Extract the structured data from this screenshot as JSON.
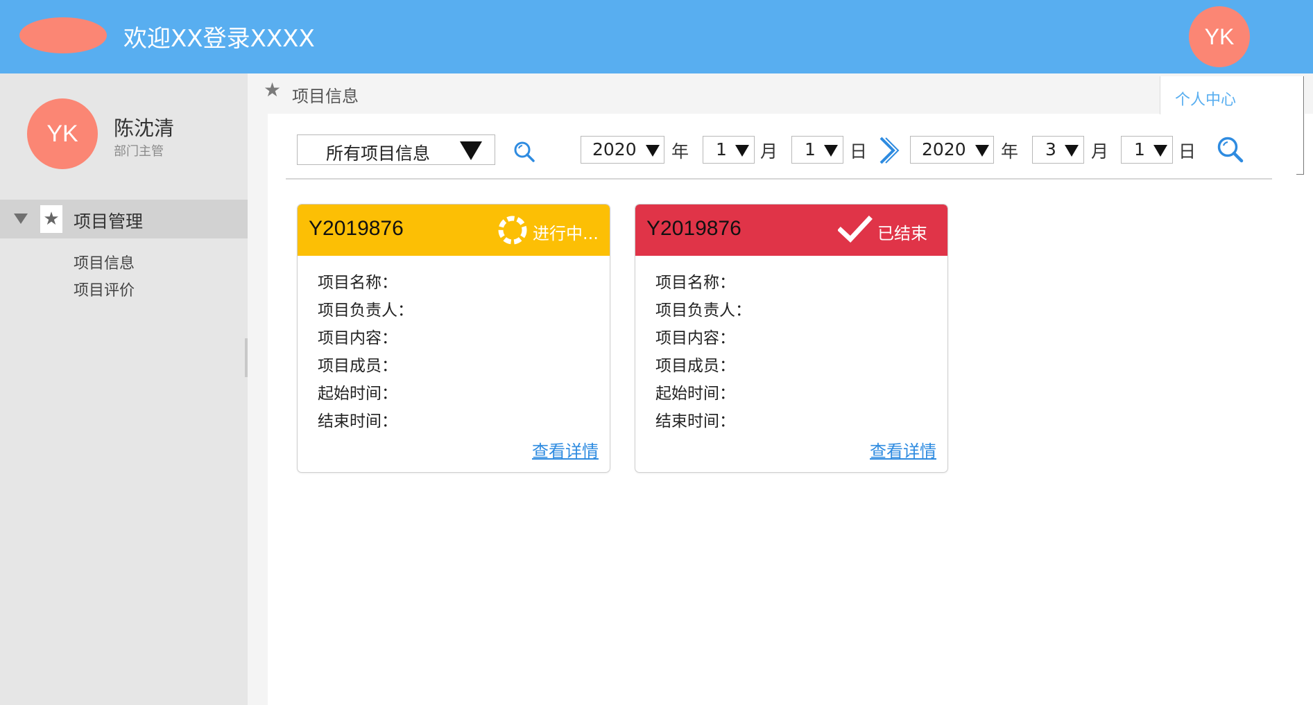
{
  "header": {
    "title": "欢迎XX登录XXXX",
    "avatar_initials": "YK",
    "logo_color": "#fb8674",
    "bg_color": "#58aef0"
  },
  "sidebar": {
    "avatar_initials": "YK",
    "user_name": "陈沈清",
    "user_role": "部门主管",
    "menu_group": {
      "label": "项目管理",
      "icon": "star-icon",
      "expanded": true
    },
    "items": [
      {
        "label": "项目信息"
      },
      {
        "label": "项目评价"
      }
    ]
  },
  "breadcrumb": {
    "icon": "star-icon",
    "label": "项目信息"
  },
  "personal_center": "个人中心",
  "filters": {
    "project_scope": "所有项目信息",
    "start": {
      "year": "2020",
      "month": "1",
      "day": "1"
    },
    "end": {
      "year": "2020",
      "month": "3",
      "day": "1"
    },
    "year_unit": "年",
    "month_unit": "月",
    "day_unit": "日"
  },
  "cards": [
    {
      "id": "Y2019876",
      "status": "进行中...",
      "status_icon": "loading-icon",
      "header_color": "#fcbf05",
      "fields": [
        "项目名称：",
        "项目负责人：",
        "项目内容：",
        "项目成员：",
        "起始时间：",
        "结束时间："
      ],
      "link": "查看详情"
    },
    {
      "id": "Y2019876",
      "status": "已结束",
      "status_icon": "check-icon",
      "header_color": "#e03448",
      "fields": [
        "项目名称：",
        "项目负责人：",
        "项目内容：",
        "项目成员：",
        "起始时间：",
        "结束时间："
      ],
      "link": "查看详情"
    }
  ]
}
